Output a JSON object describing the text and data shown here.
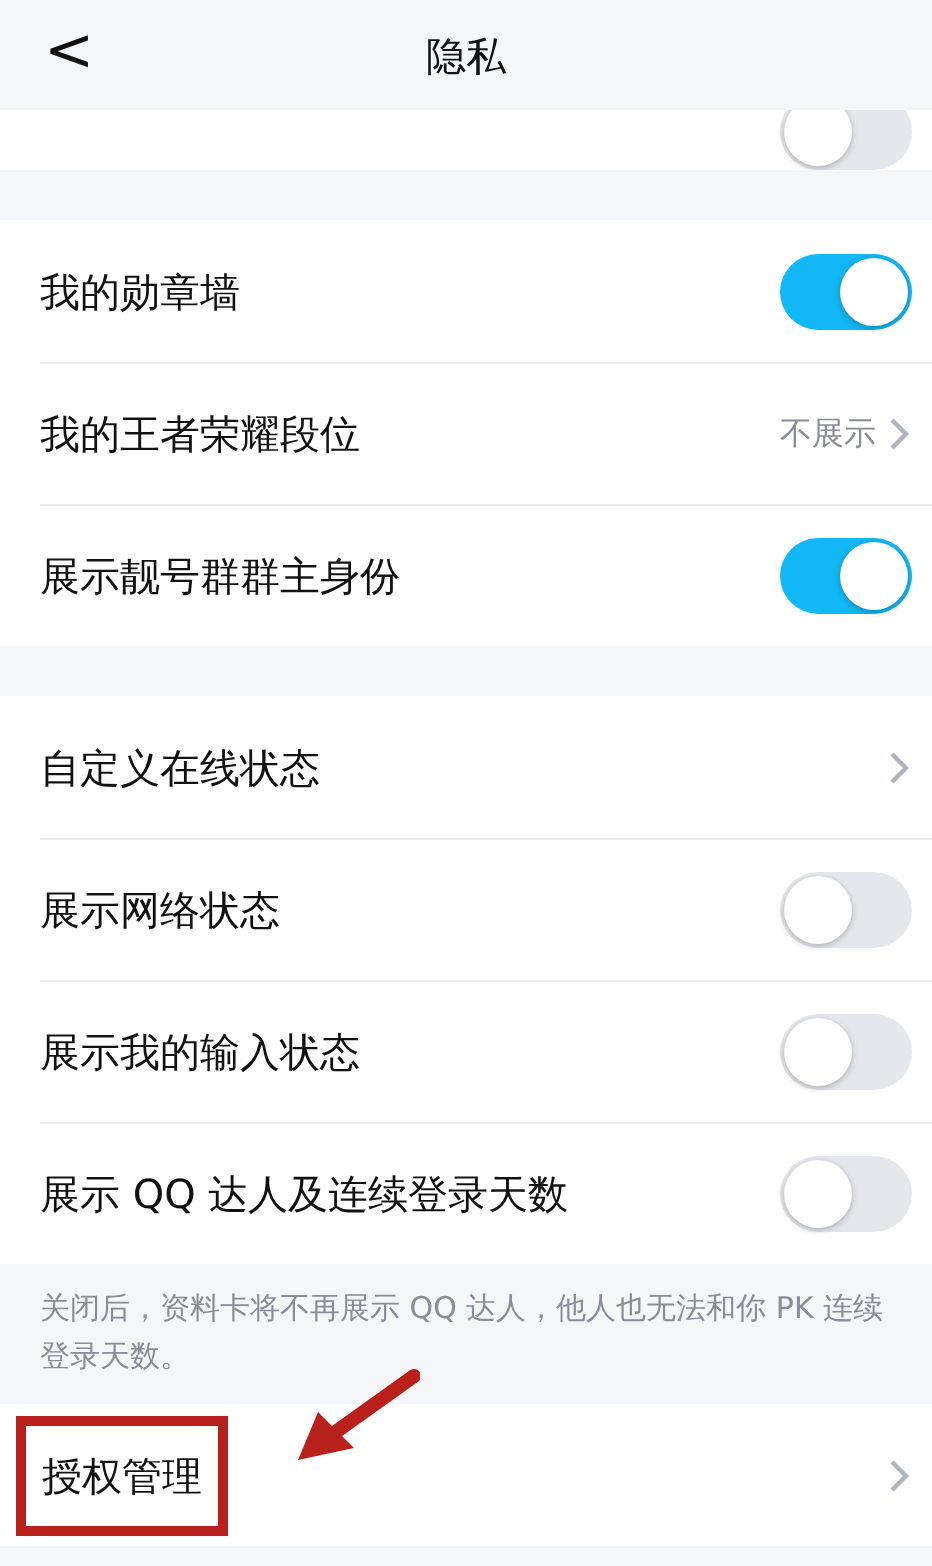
{
  "header": {
    "back": "<",
    "title": "隐私"
  },
  "sections": [
    {
      "rows": [
        {
          "kind": "toggle",
          "label": "",
          "on": false
        }
      ]
    },
    {
      "rows": [
        {
          "kind": "toggle",
          "label": "我的勋章墙",
          "on": true
        },
        {
          "kind": "value",
          "label": "我的王者荣耀段位",
          "value": "不展示"
        },
        {
          "kind": "toggle",
          "label": "展示靓号群群主身份",
          "on": true
        }
      ]
    },
    {
      "rows": [
        {
          "kind": "link",
          "label": "自定义在线状态"
        },
        {
          "kind": "toggle",
          "label": "展示网络状态",
          "on": false
        },
        {
          "kind": "toggle",
          "label": "展示我的输入状态",
          "on": false
        },
        {
          "kind": "toggle",
          "label": "展示 QQ 达人及连续登录天数",
          "on": false
        }
      ],
      "footnote": "关闭后，资料卡将不再展示 QQ 达人，他人也无法和你 PK 连续登录天数。"
    },
    {
      "rows": [
        {
          "kind": "link",
          "label": "授权管理",
          "highlighted": true
        }
      ]
    }
  ]
}
